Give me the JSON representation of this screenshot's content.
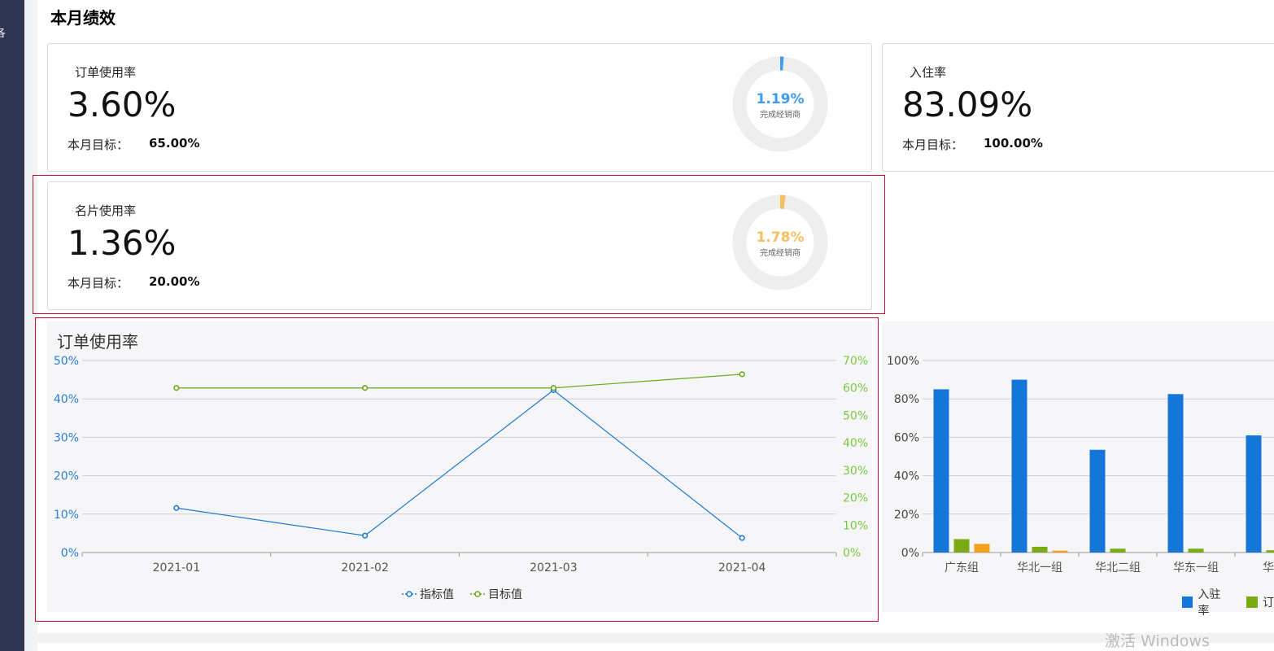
{
  "page": {
    "title": "本月绩效"
  },
  "cards": [
    {
      "label": "订单使用率",
      "value": "3.60%",
      "target_label": "本月目标：",
      "target_value": "65.00%",
      "donut": {
        "percent_text": "1.19%",
        "percent": 0.0119,
        "sub": "完成经销商",
        "color": "#3d9bf0"
      }
    },
    {
      "label": "入住率",
      "value": "83.09%",
      "target_label": "本月目标：",
      "target_value": "100.00%"
    },
    {
      "label": "名片使用率",
      "value": "1.36%",
      "target_label": "本月目标：",
      "target_value": "20.00%",
      "donut": {
        "percent_text": "1.78%",
        "percent": 0.0178,
        "sub": "完成经销商",
        "color": "#f5c060"
      }
    }
  ],
  "chart_data": [
    {
      "type": "line",
      "title": "订单使用率",
      "x": [
        "2021-01",
        "2021-02",
        "2021-03",
        "2021-04"
      ],
      "y_left": {
        "ticks": [
          "0%",
          "10%",
          "20%",
          "30%",
          "40%",
          "50%"
        ],
        "range": [
          0,
          50
        ],
        "color": "#2a7fd4"
      },
      "y_right": {
        "ticks": [
          "0%",
          "10%",
          "20%",
          "30%",
          "40%",
          "50%",
          "60%",
          "70%"
        ],
        "range": [
          0,
          70
        ],
        "color": "#7ac943"
      },
      "series": [
        {
          "name": "指标值",
          "axis": "left",
          "values": [
            11.6,
            4.4,
            42.3,
            3.8
          ],
          "color": "#1a78d4"
        },
        {
          "name": "目标值",
          "axis": "right",
          "values": [
            60,
            60,
            60,
            65
          ],
          "color": "#6aa81a"
        }
      ],
      "grid": true,
      "legend": "bottom-center"
    },
    {
      "type": "bar",
      "categories": [
        "广东组",
        "华北一组",
        "华北二组",
        "华东一组",
        "华东"
      ],
      "y_ticks": [
        "0%",
        "20%",
        "40%",
        "60%",
        "80%",
        "100%"
      ],
      "ylim": [
        0,
        100
      ],
      "series": [
        {
          "name": "入驻率",
          "values": [
            85,
            90,
            53.5,
            82.5,
            61
          ],
          "color": "#1477d8"
        },
        {
          "name": "订",
          "values": [
            7,
            3,
            2,
            2,
            1.2
          ],
          "color": "#7aaa14"
        },
        {
          "name": "",
          "values": [
            4.5,
            1,
            0,
            0,
            0
          ],
          "color": "#f4a11c"
        }
      ],
      "grid": true,
      "legend": "bottom-right"
    }
  ],
  "watermark": "激活 Windows",
  "sidebar": {
    "glyph": "各"
  }
}
